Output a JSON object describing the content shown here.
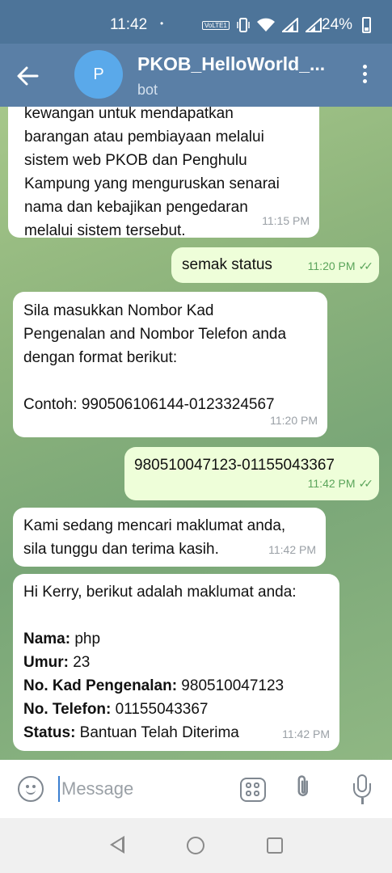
{
  "status_bar": {
    "time": "11:42",
    "dot": "•",
    "volte": "VoLTE1",
    "battery": "24%"
  },
  "header": {
    "avatar_letter": "P",
    "title": "PKOB_HelloWorld_...",
    "subtitle": "bot",
    "back_icon": "arrow-left-icon",
    "menu_icon": "more-vertical-icon"
  },
  "messages": [
    {
      "direction": "in",
      "lines": [
        "kewangan untuk mendapatkan",
        "barangan atau pembiayaan melalui",
        "sistem web PKOB dan Penghulu",
        "Kampung yang menguruskan senarai",
        "nama dan kebajikan pengedaran",
        "melalui sistem tersebut."
      ],
      "time": "11:15 PM"
    },
    {
      "direction": "out",
      "text": "semak status",
      "time": "11:20 PM",
      "ticks": "✓✓"
    },
    {
      "direction": "in",
      "lines": [
        "Sila masukkan Nombor Kad",
        "Pengenalan and Nombor Telefon anda",
        "dengan format berikut:",
        "",
        "Contoh: 990506106144-0123324567"
      ],
      "time": "11:20 PM"
    },
    {
      "direction": "out",
      "text": "980510047123-01155043367",
      "time": "11:42 PM",
      "ticks": "✓✓"
    },
    {
      "direction": "in",
      "lines": [
        "Kami sedang mencari maklumat anda,",
        "sila tunggu dan terima kasih."
      ],
      "time": "11:42 PM"
    },
    {
      "direction": "in",
      "intro": "Hi Kerry, berikut adalah maklumat anda:",
      "fields": [
        {
          "label": "Nama:",
          "value": " php"
        },
        {
          "label": "Umur:",
          "value": " 23"
        },
        {
          "label": "No. Kad Pengenalan:",
          "value": " 980510047123"
        },
        {
          "label": "No. Telefon:",
          "value": " 01155043367"
        },
        {
          "label": "Status:",
          "value": " Bantuan Telah Diterima"
        }
      ],
      "time": "11:42 PM"
    }
  ],
  "composer": {
    "placeholder": "Message",
    "emoji_icon": "emoji-icon",
    "sticker_icon": "sticker-icon",
    "attach_icon": "paperclip-icon",
    "mic_icon": "microphone-icon"
  },
  "colors": {
    "header": "#5a7fa6",
    "status_bar": "#4d7499",
    "incoming_bubble": "#ffffff",
    "outgoing_bubble": "#eefed9",
    "avatar": "#5aa9ea",
    "tick": "#5aa45a"
  }
}
